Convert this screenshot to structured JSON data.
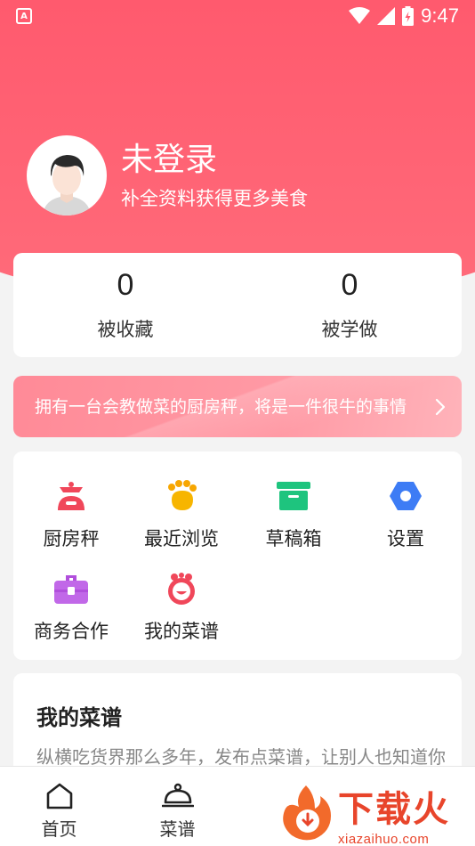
{
  "status": {
    "time": "9:47",
    "app_letter": "A"
  },
  "profile": {
    "name": "未登录",
    "subtitle": "补全资料获得更多美食"
  },
  "stats": [
    {
      "value": "0",
      "label": "被收藏"
    },
    {
      "value": "0",
      "label": "被学做"
    }
  ],
  "banner": {
    "text": "拥有一台会教做菜的厨房秤，将是一件很牛的事情"
  },
  "tools": [
    {
      "label": "厨房秤",
      "icon": "scale-icon",
      "color": "#f0475a"
    },
    {
      "label": "最近浏览",
      "icon": "paw-icon",
      "color": "#f7b500"
    },
    {
      "label": "草稿箱",
      "icon": "drafts-box-icon",
      "color": "#1ec47e"
    },
    {
      "label": "设置",
      "icon": "gear-hexagon-icon",
      "color": "#3d7cf5"
    },
    {
      "label": "商务合作",
      "icon": "briefcase-icon",
      "color": "#c168e8"
    },
    {
      "label": "我的菜谱",
      "icon": "recipe-face-icon",
      "color": "#f0475a"
    }
  ],
  "my_recipes": {
    "title": "我的菜谱",
    "description": "纵横吃货界那么多年，发布点菜谱，让别人也知道你"
  },
  "nav": [
    {
      "label": "首页",
      "icon": "home-icon"
    },
    {
      "label": "菜谱",
      "icon": "cloche-icon"
    }
  ],
  "watermark": {
    "main": "下载火",
    "sub": "xiazaihuo.com"
  }
}
